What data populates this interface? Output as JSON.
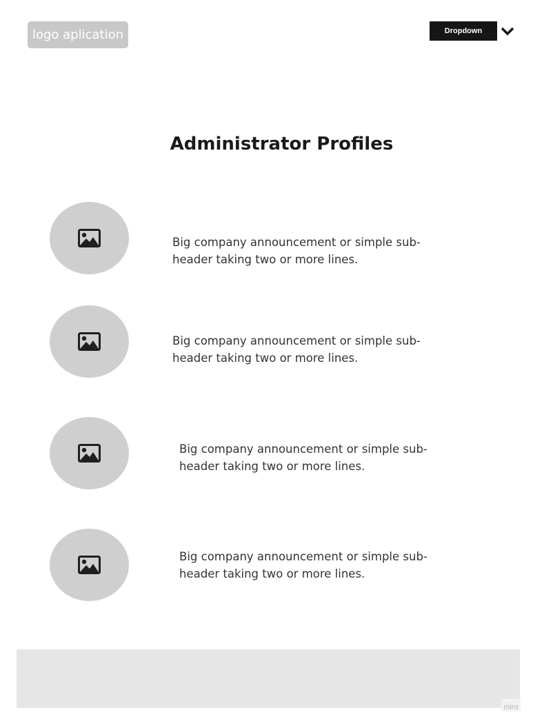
{
  "header": {
    "logo_text": "logo aplication",
    "dropdown_label": "Dropdown",
    "dropdown_icon": "chevron-down-icon"
  },
  "main": {
    "title": "Administrator Profiles",
    "profiles": [
      {
        "image_icon": "image-icon",
        "text": "Big company announcement or simple sub-header taking two or more lines."
      },
      {
        "image_icon": "image-icon",
        "text": "Big company announcement or simple sub-header taking two or more lines."
      },
      {
        "image_icon": "image-icon",
        "text": "Big company announcement or simple sub-header taking two or more lines."
      },
      {
        "image_icon": "image-icon",
        "text": "Big company announcement or simple sub-header taking two or more lines."
      }
    ]
  },
  "footer": {
    "brand_text": "miro"
  },
  "colors": {
    "logo_bg": "#c8c8c8",
    "dropdown_bg": "#161616",
    "avatar_bg": "#cfcfcf",
    "footer_bg": "#e6e6e6",
    "text": "#333333"
  }
}
